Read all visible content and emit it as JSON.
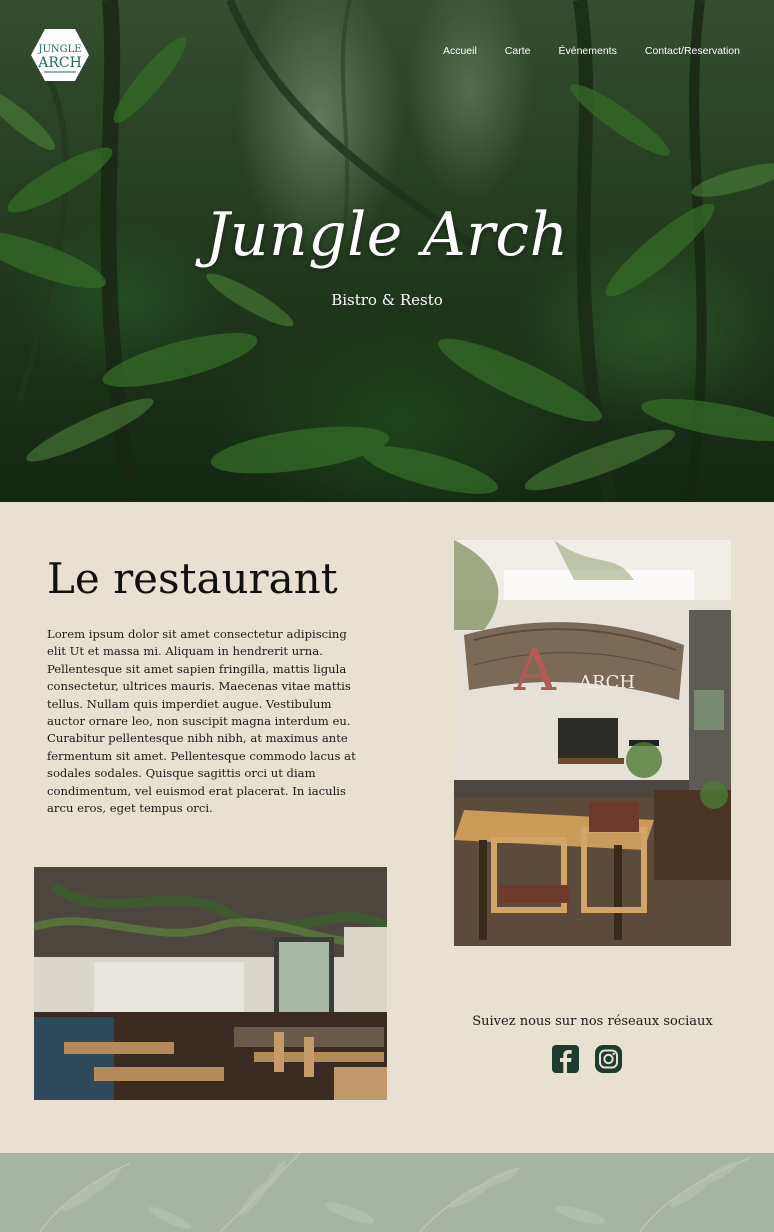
{
  "header": {
    "logo_text_top": "JUNGLE",
    "logo_text_bottom": "ARCH",
    "nav": [
      {
        "label": "Accueil"
      },
      {
        "label": "Carte"
      },
      {
        "label": "Événements"
      },
      {
        "label": "Contact/Reservation"
      }
    ]
  },
  "hero": {
    "title": "Jungle Arch",
    "subtitle": "Bistro & Resto"
  },
  "restaurant": {
    "title": "Le restaurant",
    "text": "Lorem ipsum dolor sit amet consectetur adipiscing elit Ut et massa mi. Aliquam in hendrerit urna. Pellentesque sit amet sapien fringilla, mattis ligula consectetur, ultrices mauris. Maecenas vitae mattis tellus. Nullam quis imperdiet augue. Vestibulum auctor ornare leo, non suscipit magna interdum eu. Curabitur pellentesque nibh nibh, at maximus ante fermentum sit amet. Pellentesque commodo lacus at sodales sodales. Quisque sagittis orci ut diam condimentum, vel euismod erat placerat. In iaculis arcu eros, eget tempus orci."
  },
  "photos": {
    "right_sign_text": "ARCH"
  },
  "social": {
    "caption": "Suivez nous sur nos réseaux sociaux",
    "icons": [
      "facebook-icon",
      "instagram-icon"
    ]
  },
  "colors": {
    "page_bg": "#e8e0d0",
    "footer_bg": "#a7b4a3",
    "social_icon": "#1f3a2e",
    "logo_green": "#1e6b57"
  }
}
